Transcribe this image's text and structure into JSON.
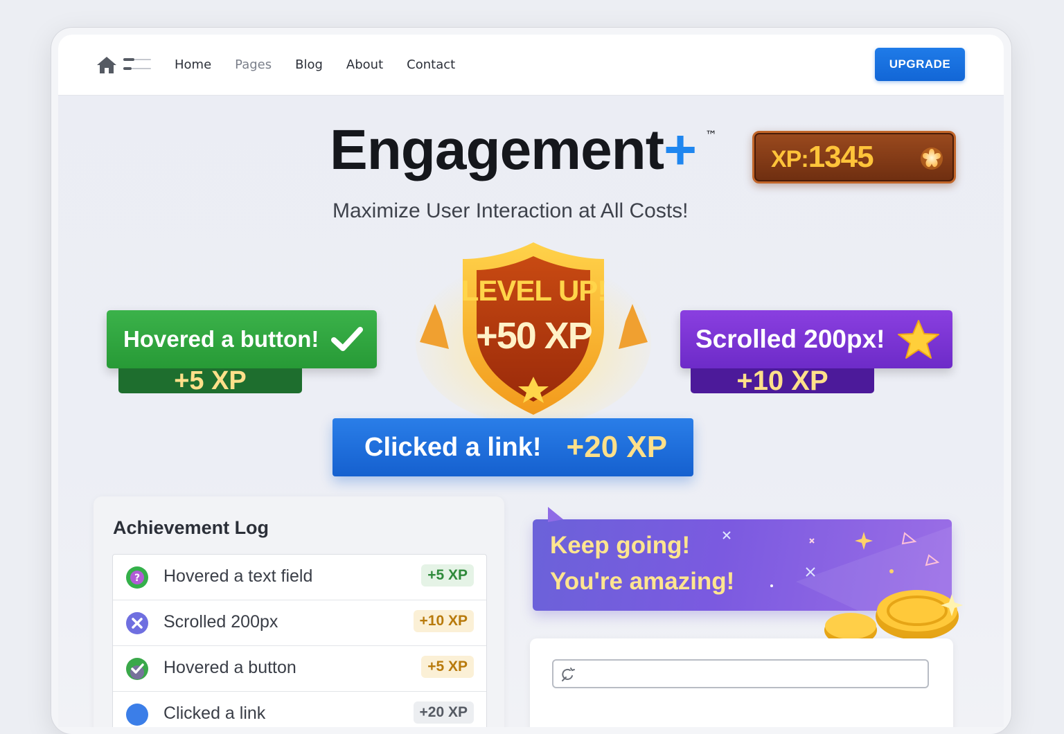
{
  "nav": {
    "links": [
      "Home",
      "Pages",
      "Blog",
      "About",
      "Contact"
    ],
    "upgrade_label": "UPGRADE"
  },
  "header": {
    "title": "Engagement",
    "title_plus": "+",
    "trademark": "™",
    "subtitle": "Maximize User Interaction at All Costs!",
    "xp_label": "XP:",
    "xp_value": "1345"
  },
  "rewards": {
    "hover": {
      "label": "Hovered a button!",
      "points": "+5 XP"
    },
    "level": {
      "line1": "LEVEL UP!",
      "line2": "+50 XP"
    },
    "scroll": {
      "label": "Scrolled 200px!",
      "points": "+10 XP"
    },
    "click": {
      "label": "Clicked a link!",
      "points": "+20 XP"
    }
  },
  "achievement_log": {
    "title": "Achievement Log",
    "items": [
      {
        "text": "Hovered a text field",
        "points": "+5 XP"
      },
      {
        "text": "Scrolled 200px",
        "points": "+10 XP"
      },
      {
        "text": "Hovered a button",
        "points": "+5 XP"
      },
      {
        "text": "Clicked a link",
        "points": "+20 XP"
      }
    ]
  },
  "encouragement": {
    "line1": "Keep going!",
    "line2": "You're amazing!"
  },
  "search": {
    "placeholder": ""
  },
  "colors": {
    "accent": "#1f86ef",
    "green": "#2ca23c",
    "purple": "#7a35d6",
    "blue": "#1a6ee0",
    "gold": "#ffc43a"
  }
}
